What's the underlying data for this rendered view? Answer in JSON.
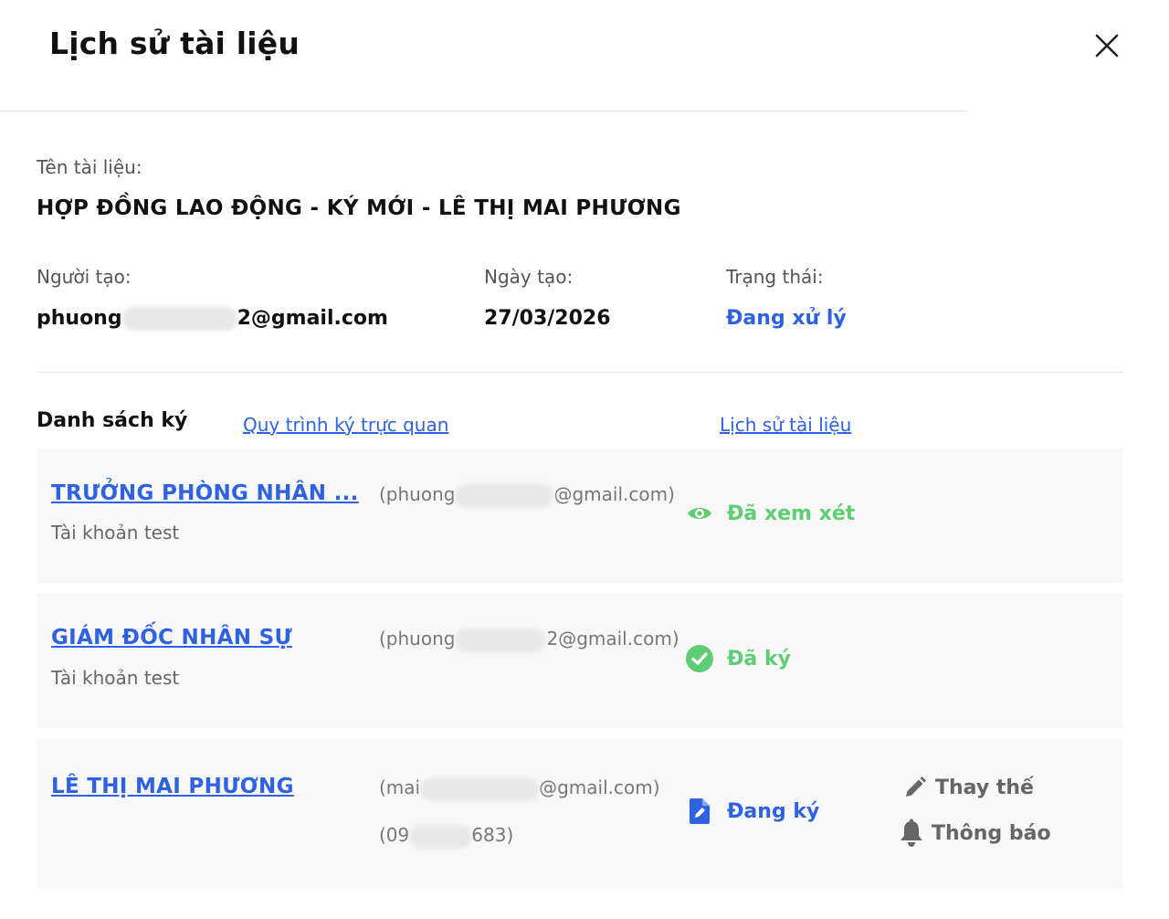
{
  "header": {
    "title": "Lịch sử tài liệu",
    "close_icon": "close-icon"
  },
  "document": {
    "name_label": "Tên tài liệu:",
    "name": "HỢP ĐỒNG LAO ĐỘNG - KÝ MỚI - LÊ THỊ MAI PHƯƠNG",
    "creator_label": "Người tạo:",
    "creator_prefix": "phuong",
    "creator_suffix": "2@gmail.com",
    "created_date_label": "Ngày tạo:",
    "created_date": "27/03/2026",
    "status_label": "Trạng thái:",
    "status": "Đang xử lý",
    "status_color": "#2f62e0"
  },
  "signing": {
    "heading": "Danh sách ký",
    "visual_flow_link": "Quy trình ký trực quan",
    "history_link": "Lịch sử tài liệu",
    "signers": [
      {
        "name": "TRƯỞNG PHÒNG NHÂN ...",
        "subtitle": "Tài khoản test",
        "email_prefix": "(phuong",
        "email_suffix": "@gmail.com)",
        "status": "Đã xem xét",
        "status_icon": "eye-icon",
        "status_color": "#5fcd73"
      },
      {
        "name": "GIÁM ĐỐC NHÂN SỰ",
        "subtitle": "Tài khoản test",
        "email_prefix": "(phuong",
        "email_suffix": "2@gmail.com)",
        "status": "Đã ký",
        "status_icon": "check-circle-icon",
        "status_color": "#5fcd73"
      },
      {
        "name": "LÊ THỊ MAI PHƯƠNG",
        "email_prefix": "(mai",
        "email_suffix": "@gmail.com)",
        "phone_prefix": "(09",
        "phone_suffix": "683)",
        "status": "Đang ký",
        "status_icon": "sign-document-icon",
        "status_color": "#2f62e0",
        "actions": [
          {
            "label": "Thay thế",
            "icon": "pencil-icon"
          },
          {
            "label": "Thông báo",
            "icon": "bell-icon"
          }
        ]
      }
    ]
  }
}
